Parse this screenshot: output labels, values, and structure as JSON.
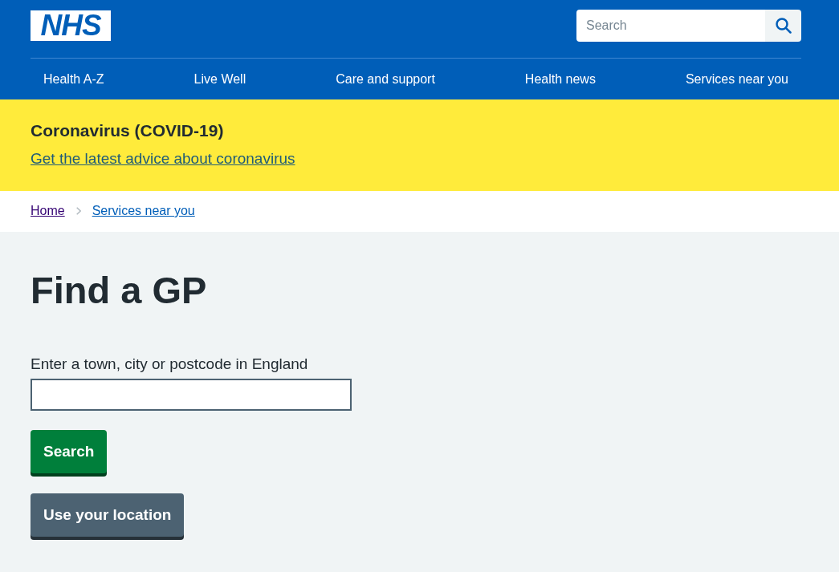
{
  "header": {
    "logo": "NHS",
    "search": {
      "placeholder": "Search"
    },
    "nav": [
      "Health A-Z",
      "Live Well",
      "Care and support",
      "Health news",
      "Services near you"
    ]
  },
  "banner": {
    "title": "Coronavirus (COVID-19)",
    "link": "Get the latest advice about coronavirus"
  },
  "breadcrumb": [
    {
      "label": "Home",
      "visited": true
    },
    {
      "label": "Services near you",
      "visited": false
    }
  ],
  "page": {
    "title": "Find a GP",
    "field": {
      "label": "Enter a town, city or postcode in England"
    },
    "buttons": [
      {
        "label": "Search",
        "kind": "primary"
      },
      {
        "label": "Use your location",
        "kind": "secondary"
      }
    ]
  }
}
